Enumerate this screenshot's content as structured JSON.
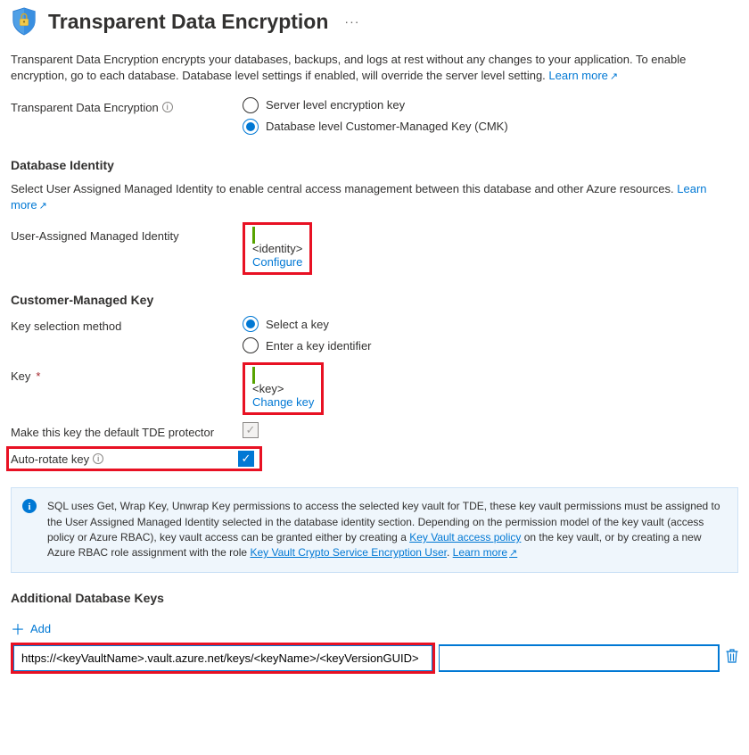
{
  "header": {
    "title": "Transparent Data Encryption"
  },
  "description": {
    "text1": "Transparent Data Encryption encrypts your databases, backups, and logs at rest without any changes to your application. To enable encryption, go to each database. Database level settings if enabled, will override the server level setting.",
    "learn_more": "Learn more"
  },
  "tde_option": {
    "label": "Transparent Data Encryption",
    "opt1": "Server level encryption key",
    "opt2": "Database level Customer-Managed Key (CMK)"
  },
  "db_identity": {
    "heading": "Database Identity",
    "desc": "Select User Assigned Managed Identity to enable central access management between this database and other Azure resources.",
    "learn_more": "Learn more",
    "uami_label": "User-Assigned Managed Identity",
    "uami_value": "<identity>",
    "configure": "Configure"
  },
  "cmk": {
    "heading": "Customer-Managed Key",
    "selection_label": "Key selection method",
    "opt1": "Select a key",
    "opt2": "Enter a key identifier",
    "key_label": "Key",
    "key_value": "<key>",
    "change_key": "Change key",
    "default_protector_label": "Make this key the default TDE protector",
    "auto_rotate_label": "Auto-rotate key"
  },
  "info_panel": {
    "text1": "SQL uses Get, Wrap Key, Unwrap Key permissions to access the selected key vault for TDE, these key vault permissions must be assigned to the User Assigned Managed Identity selected in the database identity section. Depending on the permission model of the key vault (access policy or Azure RBAC), key vault access can be granted either by creating a ",
    "link1": "Key Vault access policy",
    "text2": " on the key vault, or by creating a new Azure RBAC role assignment with the role ",
    "link2": "Key Vault Crypto Service Encryption User",
    "text3": ". ",
    "learn_more": "Learn more"
  },
  "additional_keys": {
    "heading": "Additional Database Keys",
    "add": "Add",
    "url_value": "https://<keyVaultName>.vault.azure.net/keys/<keyName>/<keyVersionGUID>"
  }
}
